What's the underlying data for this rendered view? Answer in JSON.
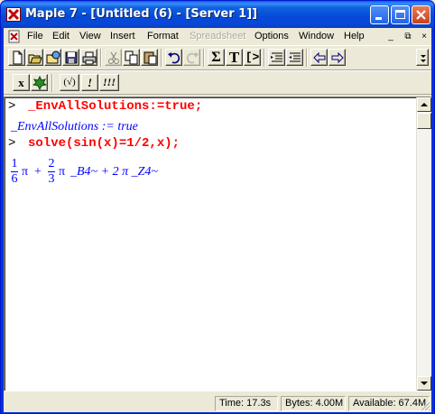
{
  "window": {
    "title": "Maple 7  - [Untitled (6) - [Server 1]]",
    "app_icon": "maple-leaf-icon",
    "controls": [
      "minimize-icon",
      "maximize-icon",
      "close-icon"
    ]
  },
  "menubar": {
    "items": [
      {
        "label": "File",
        "disabled": false
      },
      {
        "label": "Edit",
        "disabled": false
      },
      {
        "label": "View",
        "disabled": false
      },
      {
        "label": "Insert",
        "disabled": false
      },
      {
        "label": "Format",
        "disabled": false
      },
      {
        "label": "Spreadsheet",
        "disabled": true
      },
      {
        "label": "Options",
        "disabled": false
      },
      {
        "label": "Window",
        "disabled": false
      },
      {
        "label": "Help",
        "disabled": false
      }
    ],
    "mdi_minimize": "_",
    "mdi_restore": "⧉",
    "mdi_close": "×"
  },
  "toolbar": {
    "buttons": [
      "new-icon",
      "open-icon",
      "open-url-icon",
      "save-icon",
      "print-icon",
      "cut-icon",
      "copy-icon",
      "paste-icon",
      "undo-icon",
      "redo-icon",
      "sum-icon",
      "text-icon",
      "prompt-icon",
      "indent-icon",
      "outdent-icon",
      "back-arrow-icon",
      "forward-arrow-icon"
    ],
    "sum_label": "Σ",
    "text_label": "T",
    "prompt_label": "[>"
  },
  "context_toolbar": {
    "x_label": "x",
    "check_label": "(√)",
    "exec_label": "!",
    "exec_all_label": "!!!"
  },
  "worksheet": {
    "prompt_char": ">",
    "input1": "_EnvAllSolutions:=true;",
    "output1": "_EnvAllSolutions := true",
    "input2": "solve(sin(x)=1/2,x);",
    "output2": {
      "frac1_num": "1",
      "frac1_den": "6",
      "pi": "π",
      "plus": "+",
      "frac2_num": "2",
      "frac2_den": "3",
      "term2_rest": "_B4~ + 2 π _Z4~"
    }
  },
  "statusbar": {
    "time": "Time:  17.3s",
    "bytes": "Bytes: 4.00M",
    "available": "Available: 67.4M"
  },
  "colors": {
    "input": "#ff0000",
    "output": "#0000ff",
    "titlebar": "#0549d6"
  }
}
